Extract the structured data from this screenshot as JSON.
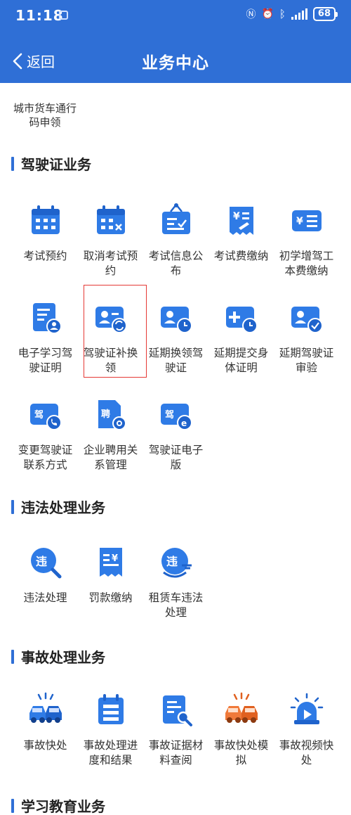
{
  "status": {
    "time": "11:18",
    "battery": "68"
  },
  "nav": {
    "back_label": "返回",
    "title": "业务中心"
  },
  "top_entry": {
    "label": "城市货车通行码申领"
  },
  "sections": [
    {
      "title": "驾驶证业务",
      "items": [
        {
          "label": "考试预约",
          "icon": "calendar-icon"
        },
        {
          "label": "取消考试预约",
          "icon": "calendar-cancel-icon"
        },
        {
          "label": "考试信息公布",
          "icon": "notice-board-icon"
        },
        {
          "label": "考试费缴纳",
          "icon": "fee-receipt-icon"
        },
        {
          "label": "初学增驾工本费缴纳",
          "icon": "fee-card-icon"
        },
        {
          "label": "电子学习驾驶证明",
          "icon": "document-user-icon"
        },
        {
          "label": "驾驶证补换领",
          "icon": "license-renew-icon"
        },
        {
          "label": "延期换领驾驶证",
          "icon": "license-clock-icon"
        },
        {
          "label": "延期提交身体证明",
          "icon": "medical-clock-icon"
        },
        {
          "label": "延期驾驶证审验",
          "icon": "license-check-icon"
        },
        {
          "label": "变更驾驶证联系方式",
          "icon": "license-phone-icon"
        },
        {
          "label": "企业聘用关系管理",
          "icon": "hire-settings-icon"
        },
        {
          "label": "驾驶证电子版",
          "icon": "license-electronic-icon"
        }
      ]
    },
    {
      "title": "违法处理业务",
      "items": [
        {
          "label": "违法处理",
          "icon": "violation-search-icon"
        },
        {
          "label": "罚款缴纳",
          "icon": "fine-receipt-icon"
        },
        {
          "label": "租赁车违法处理",
          "icon": "rental-violation-icon"
        }
      ]
    },
    {
      "title": "事故处理业务",
      "items": [
        {
          "label": "事故快处",
          "icon": "car-accident-icon"
        },
        {
          "label": "事故处理进度和结果",
          "icon": "progress-calendar-icon"
        },
        {
          "label": "事故证据材料查阅",
          "icon": "evidence-search-icon"
        },
        {
          "label": "事故快处模拟",
          "icon": "car-accident-orange-icon"
        },
        {
          "label": "事故视频快处",
          "icon": "video-siren-icon"
        }
      ]
    },
    {
      "title": "学习教育业务",
      "items": []
    }
  ],
  "colors": {
    "primary": "#2f6fd6",
    "icon_blue": "#2f7be6",
    "accent_orange": "#f07a3a",
    "highlight": "#e53935"
  }
}
